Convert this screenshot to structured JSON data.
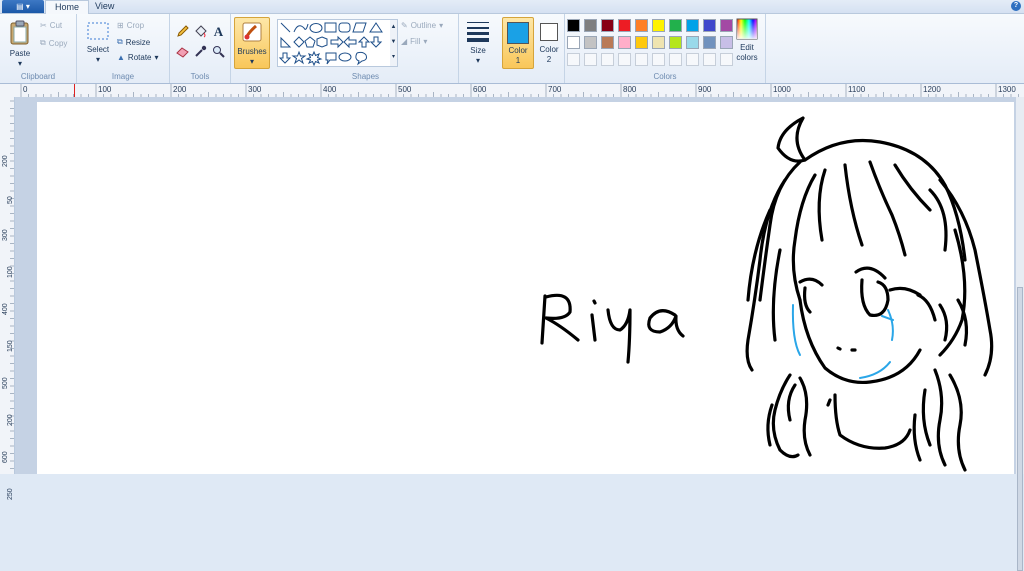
{
  "tabs": {
    "home": "Home",
    "view": "View"
  },
  "clipboard": {
    "group_label": "Clipboard",
    "paste": "Paste",
    "cut": "Cut",
    "copy": "Copy"
  },
  "image": {
    "group_label": "Image",
    "select": "Select",
    "crop": "Crop",
    "resize": "Resize",
    "rotate": "Rotate"
  },
  "tools": {
    "group_label": "Tools",
    "text_icon": "A"
  },
  "brushes": {
    "label": "Brushes"
  },
  "shapes": {
    "group_label": "Shapes",
    "outline": "Outline",
    "fill": "Fill"
  },
  "size": {
    "label": "Size"
  },
  "color1": {
    "label": "Color",
    "num": "1",
    "color": "#1aa1e6"
  },
  "color2": {
    "label": "Color",
    "num": "2",
    "color": "#ffffff"
  },
  "colors": {
    "group_label": "Colors",
    "edit": "Edit colors",
    "edit_line1": "Edit",
    "edit_line2": "colors",
    "row1": [
      "#000000",
      "#7f7f7f",
      "#880015",
      "#ed1c24",
      "#ff7f27",
      "#fff200",
      "#22b14c",
      "#00a2e8",
      "#3f48cc",
      "#a349a4"
    ],
    "row2": [
      "#ffffff",
      "#c3c3c3",
      "#b97a57",
      "#ffaec9",
      "#ffc90e",
      "#efe4b0",
      "#b5e61d",
      "#99d9ea",
      "#7092be",
      "#c8bfe7"
    ]
  },
  "ruler": {
    "top": [
      "0",
      "100",
      "200",
      "300",
      "400",
      "500",
      "600",
      "700",
      "800",
      "900",
      "1000",
      "1100",
      "1200",
      "1300"
    ],
    "left": [
      "200",
      "50",
      "300",
      "100",
      "400",
      "150",
      "500",
      "200",
      "600",
      "250"
    ]
  },
  "canvas": {
    "text": "Riya"
  }
}
